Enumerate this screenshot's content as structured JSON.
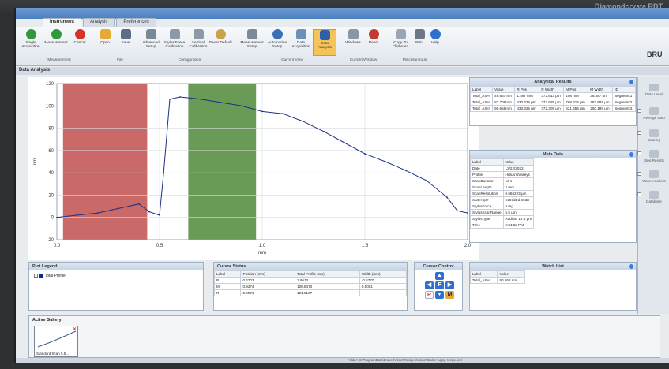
{
  "monitor": {
    "brand": "Diamondcrysta RDT"
  },
  "tabs": [
    "Instrument",
    "Analysis",
    "Preferences"
  ],
  "ribbon": {
    "buttons": [
      "Single Acquisition",
      "Measurement",
      "Cancel",
      "Open",
      "Save",
      "Advanced Setup",
      "Stylus Force Calibration",
      "Vertical Calibration",
      "Tower Default",
      "Measurement Setup",
      "Automation Setup",
      "Data Acquisition",
      "Data Analysis",
      "Windows",
      "Reset",
      "Copy To Clipboard",
      "Print",
      "Help"
    ],
    "groups": [
      "Measurement",
      "File",
      "Configuration",
      "Current View",
      "Current Window",
      "Miscellaneous"
    ],
    "logo": "BRU"
  },
  "section": {
    "title": "Data Analysis"
  },
  "analytical": {
    "title": "Analytical Results",
    "headers": [
      "Label",
      "Value",
      "R Pos",
      "R Width",
      "M Pos",
      "M Width",
      "ID"
    ],
    "rows": [
      [
        "Total_ASH",
        "46.857 nm",
        "1.497 mm",
        "372.613 μm",
        "108 mm",
        "38.887 μm",
        "Segment 1"
      ],
      [
        "Total_ASH",
        "83.708 nm",
        "430.325 μm",
        "372.685 μm",
        "768.315 μm",
        "482.685 μm",
        "Segment 2"
      ],
      [
        "Total_ASH",
        "90.658 nm",
        "433.325 μm",
        "372.305 μm",
        "621.456 μm",
        "250.195 μm",
        "Segment 3"
      ]
    ]
  },
  "meta": {
    "title": "Meta Data",
    "headers": [
      "Label",
      "Value"
    ],
    "rows": [
      [
        "Date",
        "12/22/2023"
      ],
      [
        "Profile",
        "HillsAndValleys"
      ],
      [
        "ScanDuration",
        "10 s"
      ],
      [
        "ScanLength",
        "2 mm"
      ],
      [
        "ScanResolution",
        "0.666223 μm"
      ],
      [
        "ScanType",
        "Standard Scan"
      ],
      [
        "StylusForce",
        "3 mg"
      ],
      [
        "StylusScanRange",
        "6.5 μm"
      ],
      [
        "StylusType",
        "Radius: 12.5 μm"
      ],
      [
        "Time",
        "5:34:53 PM"
      ]
    ]
  },
  "legend": {
    "title": "Plot Legend",
    "item": "Total Profile",
    "item_color": "#0a2a9a"
  },
  "cursor_status": {
    "title": "Cursor Status",
    "headers": [
      "Label",
      "Position (mm)",
      "Total Profile (nm)",
      "Width (mm)"
    ],
    "rows": [
      [
        "R",
        "0.4703",
        "2.9613",
        "-0.5770"
      ],
      [
        "M",
        "0.9274",
        "106.8470",
        "0.5001"
      ],
      [
        "R",
        "0.9571",
        "121.8107",
        ""
      ]
    ]
  },
  "cursor_control": {
    "title": "Cursor Control",
    "labels": [
      "R",
      "F",
      "M"
    ]
  },
  "watch": {
    "title": "Watch List",
    "headers": [
      "Label",
      "Value"
    ],
    "rows": [
      [
        "Total_ASH",
        "90.658 nm"
      ]
    ]
  },
  "side": [
    "Data Level",
    "Average Step",
    "Bearing",
    "Step Results",
    "Wave Analysis",
    "Database"
  ],
  "gallery": {
    "title": "Active Gallery",
    "thumb_label": "Standard Scan 5.5..."
  },
  "statusbar": "Folder: C:\\ProgramData\\Bruker\\Vision\\Recipes\\Vision\\Bruker-aging-recipe.xml",
  "chart_data": {
    "type": "line",
    "xlabel": "mm",
    "ylabel": "nm",
    "xlim": [
      0,
      2
    ],
    "ylim": [
      -20,
      120
    ],
    "x_ticks": [
      "0.0",
      "0.5",
      "1.0",
      "1.5",
      "2.0"
    ],
    "y_ticks": [
      "-20",
      "0",
      "20",
      "40",
      "60",
      "80",
      "100",
      "120"
    ],
    "regions": [
      {
        "x0": 0.03,
        "x1": 0.44,
        "color": "#c0504d"
      },
      {
        "x0": 0.64,
        "x1": 0.97,
        "color": "#4f8a3a"
      }
    ],
    "series": [
      {
        "x": [
          0.0,
          0.1,
          0.2,
          0.3,
          0.4,
          0.45,
          0.5,
          0.52,
          0.55,
          0.6,
          0.7,
          0.8,
          0.9,
          1.0,
          1.1,
          1.2,
          1.3,
          1.4,
          1.5,
          1.6,
          1.7,
          1.8,
          1.9,
          1.95,
          2.0
        ],
        "y": [
          0,
          2,
          4,
          8,
          12,
          5,
          2,
          40,
          106,
          108,
          106,
          103,
          100,
          95,
          93,
          86,
          77,
          67,
          57,
          50,
          42,
          33,
          18,
          6,
          4
        ]
      }
    ]
  }
}
